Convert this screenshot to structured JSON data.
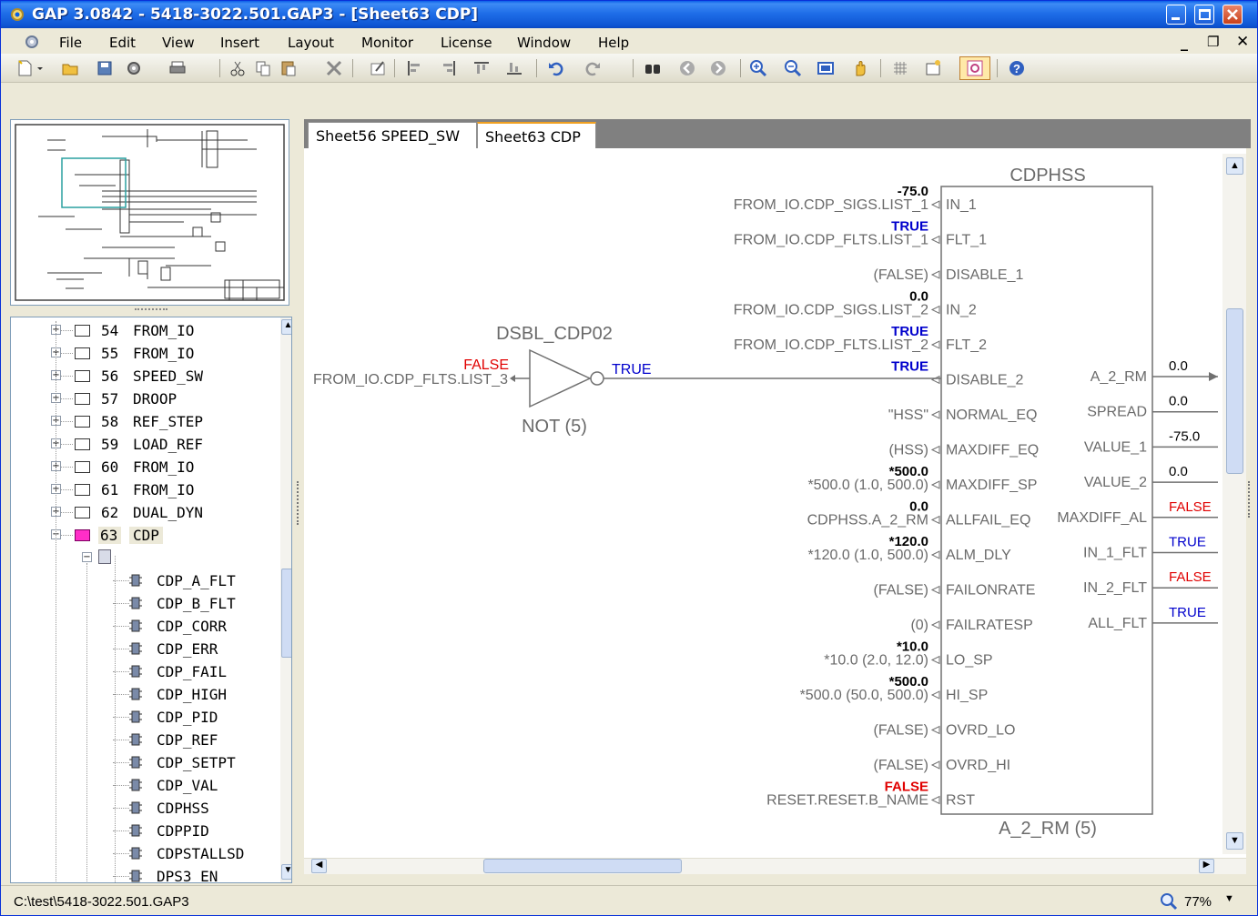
{
  "window": {
    "title": "GAP 3.0842 - 5418-3022.501.GAP3 - [Sheet63   CDP]"
  },
  "menu": [
    "File",
    "Edit",
    "View",
    "Insert",
    "Layout",
    "Monitor",
    "License",
    "Window",
    "Help"
  ],
  "tabs": [
    {
      "label": "Sheet56  SPEED_SW",
      "active": false
    },
    {
      "label": "Sheet63  CDP",
      "active": true
    }
  ],
  "tree": {
    "sheets": [
      {
        "num": "54",
        "name": "FROM_IO"
      },
      {
        "num": "55",
        "name": "FROM_IO"
      },
      {
        "num": "56",
        "name": "SPEED_SW"
      },
      {
        "num": "57",
        "name": "DROOP"
      },
      {
        "num": "58",
        "name": "REF_STEP"
      },
      {
        "num": "59",
        "name": "LOAD_REF"
      },
      {
        "num": "60",
        "name": "FROM_IO"
      },
      {
        "num": "61",
        "name": "FROM_IO"
      },
      {
        "num": "62",
        "name": "DUAL_DYN"
      },
      {
        "num": "63",
        "name": "CDP"
      }
    ],
    "blocks": [
      "CDP_A_FLT",
      "CDP_B_FLT",
      "CDP_CORR",
      "CDP_ERR",
      "CDP_FAIL",
      "CDP_HIGH",
      "CDP_PID",
      "CDP_REF",
      "CDP_SETPT",
      "CDP_VAL",
      "CDPHSS",
      "CDPPID",
      "CDPSTALLSD",
      "DPS3_EN"
    ]
  },
  "diagram": {
    "not_block": {
      "name": "DSBL_CDP02",
      "type_label": "NOT (5)",
      "input_source": "FROM_IO.CDP_FLTS.LIST_3",
      "input_value": "FALSE",
      "output_value": "TRUE"
    },
    "hss_block": {
      "name": "CDPHSS",
      "type_label": "A_2_RM (5)",
      "inputs": [
        {
          "pin": "IN_1",
          "source": "FROM_IO.CDP_SIGS.LIST_1",
          "value": "-75.0",
          "value_prefix": "<-",
          "value_color": "black"
        },
        {
          "pin": "FLT_1",
          "source": "FROM_IO.CDP_FLTS.LIST_1",
          "value": "TRUE",
          "value_prefix": "<",
          "value_color": "blue"
        },
        {
          "pin": "DISABLE_1",
          "source": "(FALSE)",
          "value": "",
          "value_prefix": "",
          "value_color": "black"
        },
        {
          "pin": "IN_2",
          "source": "FROM_IO.CDP_SIGS.LIST_2",
          "value": "0.0",
          "value_prefix": "<D",
          "value_color": "black"
        },
        {
          "pin": "FLT_2",
          "source": "FROM_IO.CDP_FLTS.LIST_2",
          "value": "TRUE",
          "value_prefix": "<",
          "value_color": "blue"
        },
        {
          "pin": "DISABLE_2",
          "source": "",
          "value": "TRUE",
          "value_prefix": "",
          "value_color": "blue"
        },
        {
          "pin": "NORMAL_EQ",
          "source": "\"HSS\"",
          "value": "",
          "value_prefix": "",
          "value_color": "black"
        },
        {
          "pin": "MAXDIFF_EQ",
          "source": "(HSS)",
          "value": "",
          "value_prefix": "",
          "value_color": "black"
        },
        {
          "pin": "MAXDIFF_SP",
          "source": "*500.0 (1.0, 500.0)",
          "value": "*500.0",
          "value_prefix": "",
          "value_color": "black"
        },
        {
          "pin": "ALLFAIL_EQ",
          "source": "CDPHSS.A_2_RM",
          "value": "0.0",
          "value_prefix": "<C",
          "value_color": "black"
        },
        {
          "pin": "ALM_DLY",
          "source": "*120.0 (1.0, 500.0)",
          "value": "*120.0",
          "value_prefix": "",
          "value_color": "black"
        },
        {
          "pin": "FAILONRATE",
          "source": "(FALSE)",
          "value": "",
          "value_prefix": "",
          "value_color": "black"
        },
        {
          "pin": "FAILRATESP",
          "source": "(0)",
          "value": "",
          "value_prefix": "",
          "value_color": "black"
        },
        {
          "pin": "LO_SP",
          "source": "*10.0 (2.0, 12.0)",
          "value": "*10.0",
          "value_prefix": "",
          "value_color": "black"
        },
        {
          "pin": "HI_SP",
          "source": "*500.0 (50.0, 500.0)",
          "value": "*500.0",
          "value_prefix": "",
          "value_color": "black"
        },
        {
          "pin": "OVRD_LO",
          "source": "(FALSE)",
          "value": "",
          "value_prefix": "",
          "value_color": "black"
        },
        {
          "pin": "OVRD_HI",
          "source": "(FALSE)",
          "value": "",
          "value_prefix": "",
          "value_color": "black"
        },
        {
          "pin": "RST",
          "source": "RESET.RESET.B_NAME",
          "value": "FALSE",
          "value_prefix": "<5(",
          "value_color": "red"
        }
      ],
      "outputs": [
        {
          "pin": "A_2_RM",
          "value": "0.0",
          "value_color": "black"
        },
        {
          "pin": "SPREAD",
          "value": "0.0",
          "value_color": "black"
        },
        {
          "pin": "VALUE_1",
          "value": "-75.0",
          "value_color": "black"
        },
        {
          "pin": "VALUE_2",
          "value": "0.0",
          "value_color": "black"
        },
        {
          "pin": "MAXDIFF_AL",
          "value": "FALSE",
          "value_color": "red"
        },
        {
          "pin": "IN_1_FLT",
          "value": "TRUE",
          "value_color": "blue"
        },
        {
          "pin": "IN_2_FLT",
          "value": "FALSE",
          "value_color": "red"
        },
        {
          "pin": "ALL_FLT",
          "value": "TRUE",
          "value_color": "blue"
        }
      ]
    }
  },
  "status": {
    "path": "C:\\test\\5418-3022.501.GAP3",
    "zoom": "77%"
  },
  "colors": {
    "true": "#0000cc",
    "false": "#e00000",
    "line": "#707070",
    "text": "#6a6a6a"
  },
  "icons": [
    "new-icon",
    "open-icon",
    "save-icon",
    "build-icon",
    "print-icon",
    "cut-icon",
    "copy-icon",
    "paste-icon",
    "delete-icon",
    "edit-icon",
    "align-left-icon",
    "align-right-icon",
    "align-top-icon",
    "align-bottom-icon",
    "undo-icon",
    "redo-icon",
    "find-icon",
    "back-icon",
    "forward-icon",
    "zoom-in-icon",
    "zoom-out-icon",
    "fit-icon",
    "pan-hand-icon",
    "grid-icon",
    "new-sheet-icon",
    "monitor-icon",
    "help-icon"
  ]
}
